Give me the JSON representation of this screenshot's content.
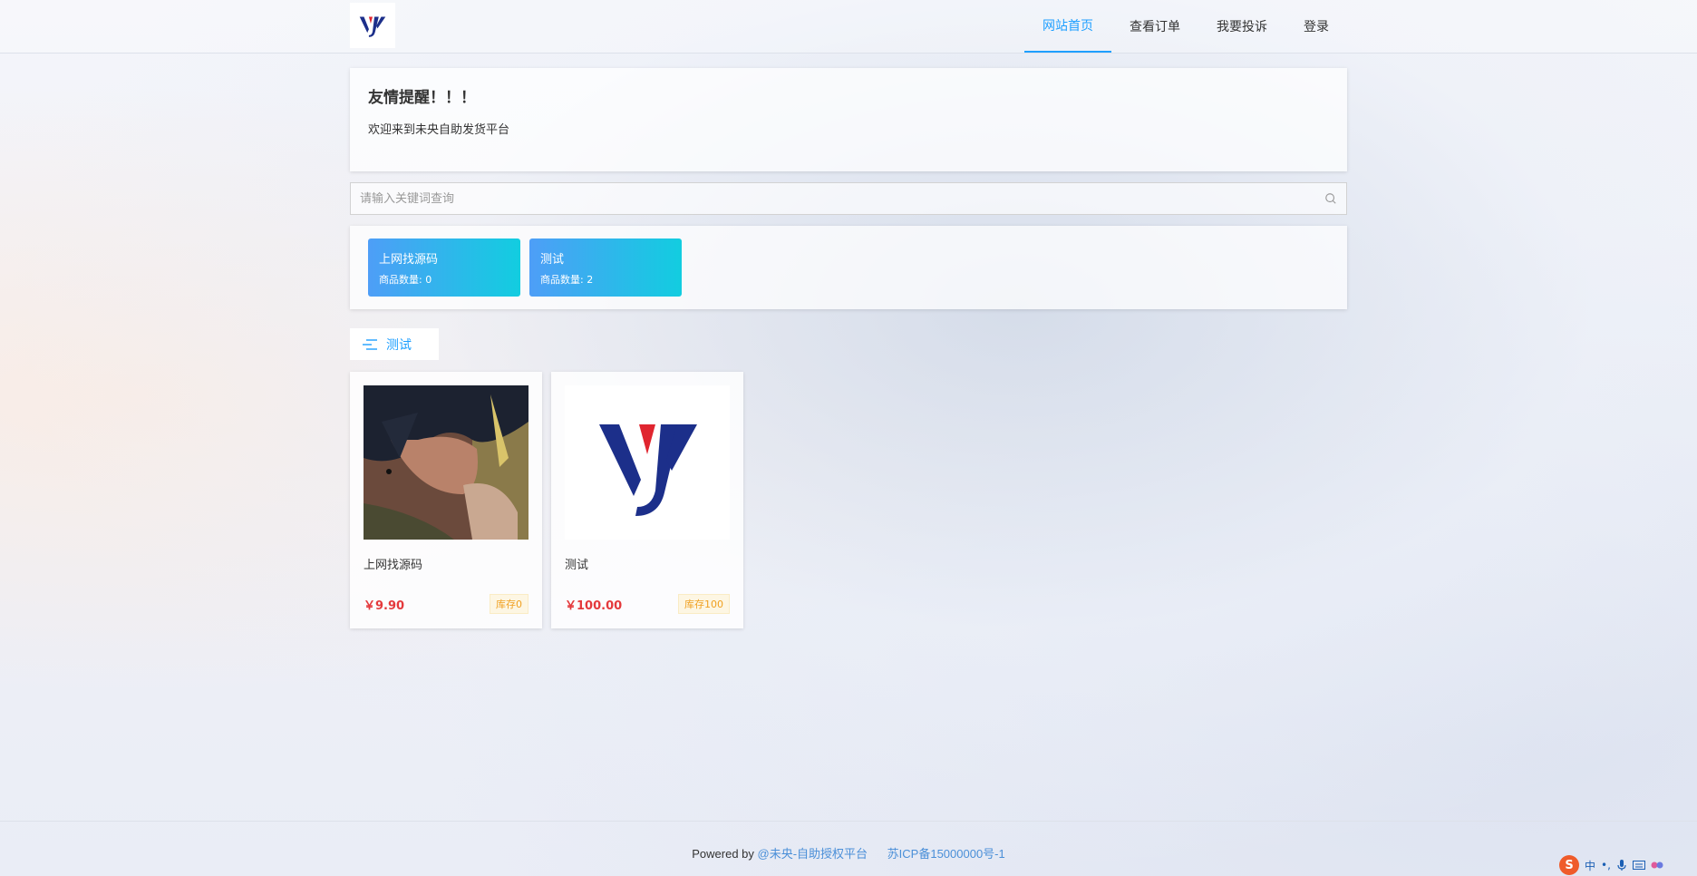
{
  "header": {
    "logo_icon": "vy-logo",
    "nav": [
      {
        "label": "网站首页",
        "active": true
      },
      {
        "label": "查看订单",
        "active": false
      },
      {
        "label": "我要投诉",
        "active": false
      },
      {
        "label": "登录",
        "active": false
      }
    ],
    "accent_color": "#1e9fff"
  },
  "notice": {
    "title": "友情提醒！！！",
    "text": "欢迎来到未央自助发货平台"
  },
  "search": {
    "placeholder": "请输入关键词查询",
    "icon": "search-icon"
  },
  "categories": [
    {
      "name": "上网找源码",
      "count_text": "商品数量: 0"
    },
    {
      "name": "测试",
      "count_text": "商品数量: 2"
    }
  ],
  "section": {
    "label": "测试",
    "icon": "menu-lines-icon"
  },
  "products": [
    {
      "name": "上网找源码",
      "price": "￥9.90",
      "stock": "库存0",
      "image": "anime-portrait-image"
    },
    {
      "name": "测试",
      "price": "￥100.00",
      "stock": "库存100",
      "image": "vy-logo-image"
    }
  ],
  "footer": {
    "powered_by": "Powered by",
    "platform_link": "@未央-自助授权平台",
    "icp": "苏ICP备15000000号-1"
  },
  "ime": {
    "s_label": "S",
    "lang_label": "中"
  }
}
